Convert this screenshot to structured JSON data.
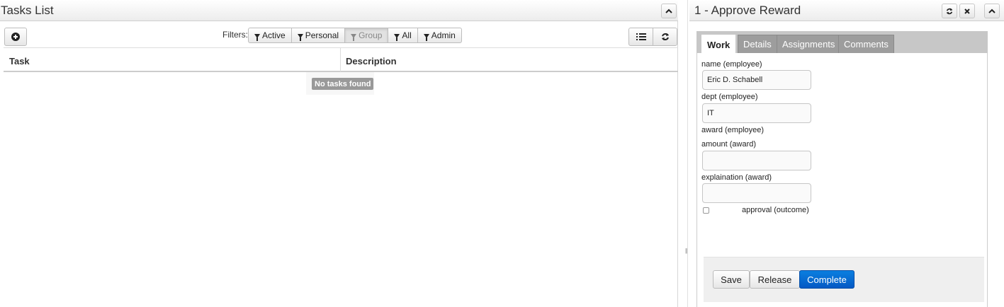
{
  "left_panel": {
    "title": "Tasks List",
    "filters_label": "Filters:",
    "filters": [
      {
        "label": "Active",
        "active": false
      },
      {
        "label": "Personal",
        "active": false
      },
      {
        "label": "Group",
        "active": true
      },
      {
        "label": "All",
        "active": false
      },
      {
        "label": "Admin",
        "active": false
      }
    ],
    "columns": [
      "Task",
      "Description"
    ],
    "empty_message": "No tasks found",
    "icons": {
      "add": "plus-circle-icon",
      "list": "list-icon",
      "refresh": "refresh-icon",
      "collapse": "chevron-up-icon",
      "filter": "filter-icon"
    }
  },
  "right_panel": {
    "title": "1 - Approve Reward",
    "tabs": [
      {
        "label": "Work",
        "active": true
      },
      {
        "label": "Details",
        "active": false
      },
      {
        "label": "Assignments",
        "active": false
      },
      {
        "label": "Comments",
        "active": false
      }
    ],
    "form": {
      "name_label": "name (employee)",
      "name_value": "Eric D. Schabell",
      "dept_label": "dept (employee)",
      "dept_value": "IT",
      "award_label": "award (employee)",
      "amount_label": "amount (award)",
      "amount_value": "",
      "explaination_label": "explaination (award)",
      "explaination_value": "",
      "approval_label": "approval (outcome)",
      "approval_checked": false
    },
    "actions": {
      "save": "Save",
      "release": "Release",
      "complete": "Complete"
    },
    "icons": {
      "refresh": "refresh-icon",
      "close": "close-icon",
      "collapse": "chevron-up-icon"
    }
  },
  "colors": {
    "primary": "#0a6fd8",
    "tab_inactive": "#9d9d9d",
    "badge": "#999999"
  }
}
